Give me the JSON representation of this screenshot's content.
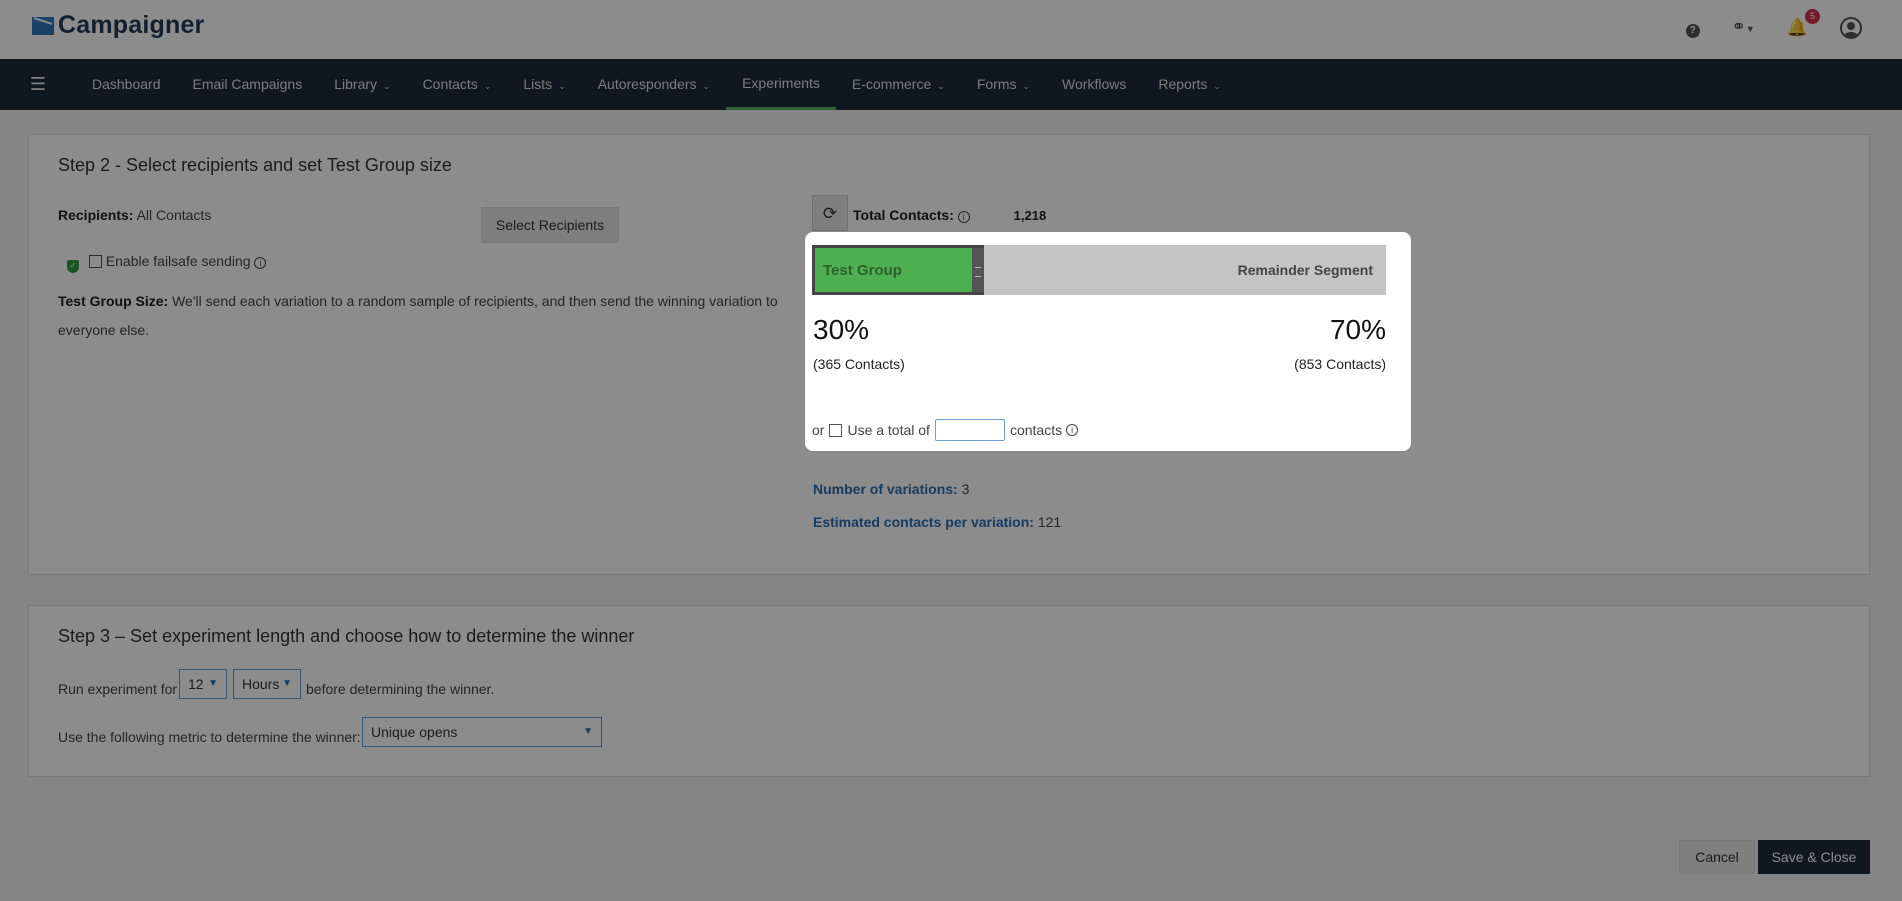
{
  "brand": {
    "name": "Campaigner"
  },
  "header": {
    "notification_count": "5",
    "help_icon": "question-circle-icon",
    "support_icon": "headset-icon",
    "bell_icon": "bell-icon",
    "user_icon": "user-circle-icon"
  },
  "nav": {
    "items": [
      {
        "label": "Dashboard",
        "dropdown": false
      },
      {
        "label": "Email Campaigns",
        "dropdown": false
      },
      {
        "label": "Library",
        "dropdown": true
      },
      {
        "label": "Contacts",
        "dropdown": true
      },
      {
        "label": "Lists",
        "dropdown": true
      },
      {
        "label": "Autoresponders",
        "dropdown": true
      },
      {
        "label": "Experiments",
        "dropdown": false,
        "active": true
      },
      {
        "label": "E-commerce",
        "dropdown": true
      },
      {
        "label": "Forms",
        "dropdown": true
      },
      {
        "label": "Workflows",
        "dropdown": false
      },
      {
        "label": "Reports",
        "dropdown": true
      }
    ]
  },
  "step2": {
    "title": "Step 2 - Select recipients and set Test Group size",
    "recipients_label": "Recipients:",
    "recipients_value": "All Contacts",
    "select_recipients_button": "Select Recipients",
    "failsafe_label": "Enable failsafe sending",
    "test_group_size_label": "Test Group Size:",
    "test_group_size_desc_1": "We'll send each variation to a random sample of recipients, and then send the winning variation to",
    "test_group_size_desc_2": "everyone else.",
    "total_contacts_label": "Total Contacts:",
    "total_contacts_value": "1,218",
    "split": {
      "test_group_label": "Test Group",
      "remainder_label": "Remainder Segment",
      "test_group_fraction": 0.3,
      "test_pct": "30%",
      "remainder_pct": "70%",
      "test_contacts": "(365 Contacts)",
      "remainder_contacts": "(853 Contacts)",
      "or_label": "or",
      "use_total_label": "Use a total of",
      "contacts_label": "contacts",
      "total_input_value": ""
    },
    "variations_label": "Number of variations:",
    "variations_value": "3",
    "estimated_label": "Estimated contacts per variation:",
    "estimated_value": "121"
  },
  "step3": {
    "title": "Step 3 – Set experiment length and choose how to determine the winner",
    "run_label": "Run experiment for",
    "run_value": "12",
    "run_unit": "Hours",
    "before_label": "before determining the winner.",
    "metric_label": "Use the following metric to determine the winner:",
    "metric_value": "Unique opens"
  },
  "footer": {
    "cancel": "Cancel",
    "save": "Save & Close"
  },
  "colors": {
    "nav_bg": "#1c2b3d",
    "active_underline": "#5cb85c",
    "test_group": "#4cb050",
    "remainder": "#c4c4c4",
    "link_blue": "#2a6db3"
  }
}
